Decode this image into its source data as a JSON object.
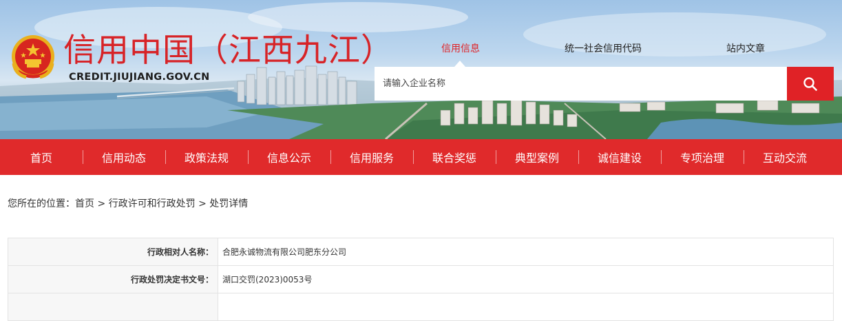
{
  "header": {
    "site_title": "信用中国（江西九江）",
    "site_domain": "CREDIT.JIUJIANG.GOV.CN",
    "emblem_icon": "national-emblem-icon"
  },
  "search": {
    "tabs": [
      {
        "label": "信用信息",
        "active": true
      },
      {
        "label": "统一社会信用代码",
        "active": false
      },
      {
        "label": "站内文章",
        "active": false
      }
    ],
    "placeholder": "请输入企业名称",
    "button_icon": "search-icon"
  },
  "nav": {
    "items": [
      "首页",
      "信用动态",
      "政策法规",
      "信息公示",
      "信用服务",
      "联合奖惩",
      "典型案例",
      "诚信建设",
      "专项治理",
      "互动交流"
    ]
  },
  "breadcrumb": {
    "prefix": "您所在的位置：",
    "items": [
      "首页",
      "行政许可和行政处罚",
      "处罚详情"
    ],
    "separator": " > "
  },
  "details": {
    "rows": [
      {
        "label": "行政相对人名称：",
        "value": "合肥永诚物流有限公司肥东分公司"
      },
      {
        "label": "行政处罚决定书文号：",
        "value": "湖口交罚(2023)0053号"
      },
      {
        "label": "",
        "value": ""
      }
    ]
  },
  "colors": {
    "brand_red": "#e02a2b",
    "title_red": "#d72327",
    "active_tab": "#e02226"
  }
}
